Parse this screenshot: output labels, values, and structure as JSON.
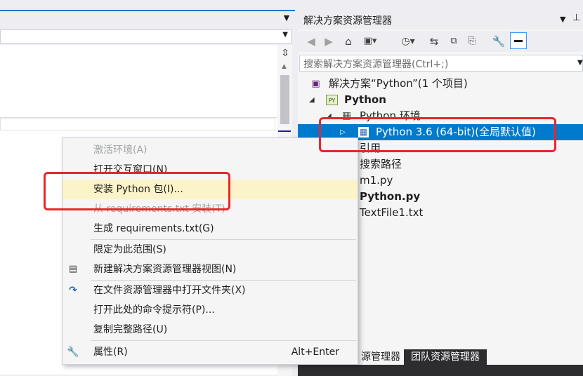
{
  "solution_explorer": {
    "title": "解决方案资源管理器",
    "search_placeholder": "搜索解决方案资源管理器(Ctrl+;)",
    "tree": {
      "solution": "解决方案“Python”(1 个项目)",
      "project": "Python",
      "py_badge": "PY",
      "env_folder": "Python 环境",
      "env_selected": "Python 3.6 (64-bit)(全局默认值)",
      "references": "引用",
      "search_paths": "搜索路径",
      "file_m1": "m1.py",
      "file_python": "Python.py",
      "file_text": "TextFile1.txt"
    },
    "bottom_tabs": {
      "tab1": "源管理器",
      "tab2": "团队资源管理器"
    }
  },
  "context_menu": {
    "items": [
      {
        "label": "激活环境(A)",
        "enabled": false
      },
      {
        "label": "打开交互窗口(N)",
        "enabled": true
      },
      {
        "label": "安装 Python 包(I)...",
        "enabled": true,
        "highlighted": true
      },
      {
        "label": "从 requirements.txt 安装(T)",
        "enabled": false
      },
      {
        "label": "生成 requirements.txt(G)",
        "enabled": true
      },
      {
        "label": "限定为此范围(S)",
        "enabled": true
      },
      {
        "label": "新建解决方案资源管理器视图(N)",
        "enabled": true
      },
      {
        "label": "在文件资源管理器中打开文件夹(X)",
        "enabled": true
      },
      {
        "label": "打开此处的命令提示符(P)...",
        "enabled": true
      },
      {
        "label": "复制完整路径(U)",
        "enabled": true
      },
      {
        "label": "属性(R)",
        "enabled": true,
        "shortcut": "Alt+Enter"
      }
    ]
  },
  "colors": {
    "selection": "#007acc",
    "highlight": "#fcf3c9",
    "annotation": "#e8272b"
  }
}
